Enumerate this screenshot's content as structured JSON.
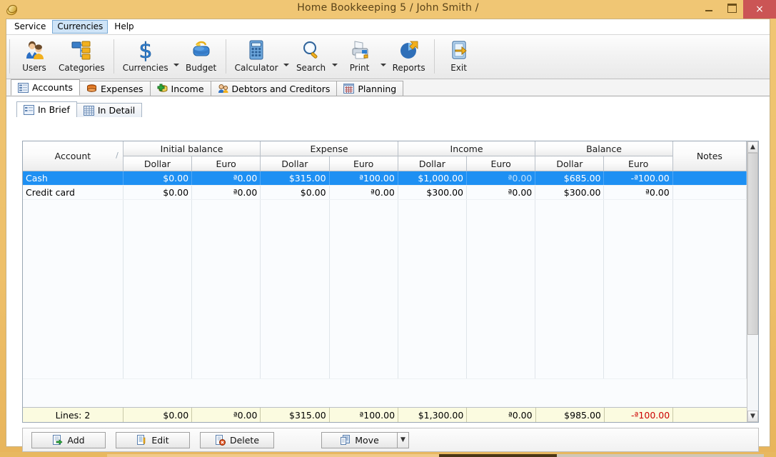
{
  "window": {
    "title": "Home Bookkeeping 5  / John Smith /",
    "icon": "coins-icon",
    "minimize": "minimize-button",
    "maximize": "maximize-button",
    "close": "×",
    "accent": "#e8b860",
    "titlebar_color": "#f0c674",
    "close_color": "#cb5555"
  },
  "menubar": {
    "items": [
      {
        "label": "Service",
        "active": false
      },
      {
        "label": "Currencies",
        "active": true
      },
      {
        "label": "Help",
        "active": false
      }
    ]
  },
  "toolbar": {
    "groups": [
      {
        "items": [
          {
            "label": "Users",
            "icon": "users-icon",
            "dropdown": false
          },
          {
            "label": "Categories",
            "icon": "categories-icon",
            "dropdown": false
          }
        ]
      },
      {
        "items": [
          {
            "label": "Currencies",
            "icon": "dollar-sign-icon",
            "dropdown": true
          },
          {
            "label": "Budget",
            "icon": "purse-icon",
            "dropdown": false
          }
        ]
      },
      {
        "items": [
          {
            "label": "Calculator",
            "icon": "calculator-icon",
            "dropdown": true
          },
          {
            "label": "Search",
            "icon": "magnifier-icon",
            "dropdown": true
          },
          {
            "label": "Print",
            "icon": "printer-icon",
            "dropdown": true
          },
          {
            "label": "Reports",
            "icon": "pie-chart-icon",
            "dropdown": false
          }
        ]
      },
      {
        "items": [
          {
            "label": "Exit",
            "icon": "exit-door-icon",
            "dropdown": false
          }
        ]
      }
    ]
  },
  "main_tabs": [
    {
      "label": "Accounts",
      "icon": "accounts-icon",
      "selected": true
    },
    {
      "label": "Expenses",
      "icon": "expenses-icon",
      "selected": false
    },
    {
      "label": "Income",
      "icon": "income-icon",
      "selected": false
    },
    {
      "label": "Debtors and Creditors",
      "icon": "debtors-icon",
      "selected": false
    },
    {
      "label": "Planning",
      "icon": "planning-icon",
      "selected": false
    }
  ],
  "sub_tabs": [
    {
      "label": "In Brief",
      "icon": "brief-list-icon",
      "selected": true
    },
    {
      "label": "In Detail",
      "icon": "detail-table-icon",
      "selected": false
    }
  ],
  "grid": {
    "group_headers": [
      {
        "label": "Account",
        "span": 1,
        "sort": "/"
      },
      {
        "label": "Initial balance",
        "span": 2
      },
      {
        "label": "Expense",
        "span": 2
      },
      {
        "label": "Income",
        "span": 2
      },
      {
        "label": "Balance",
        "span": 2
      },
      {
        "label": "Notes",
        "span": 1
      }
    ],
    "sub_headers": [
      "Dollar",
      "Euro",
      "Dollar",
      "Euro",
      "Dollar",
      "Euro",
      "Dollar",
      "Euro"
    ],
    "rows": [
      {
        "selected": true,
        "account": "Cash",
        "initial_dollar": "$0.00",
        "initial_euro": "ª0.00",
        "expense_dollar": "$315.00",
        "expense_euro": "ª100.00",
        "income_dollar": "$1,000.00",
        "income_euro": "ª0.00",
        "balance_dollar": "$685.00",
        "balance_euro": "-ª100.00",
        "notes": "",
        "dim": {
          "initial_dollar": false,
          "initial_euro": false,
          "expense_dollar": false,
          "expense_euro": false,
          "income_dollar": false,
          "income_euro": true,
          "balance_dollar": false,
          "balance_euro": false
        }
      },
      {
        "selected": false,
        "account": "Credit card",
        "initial_dollar": "$0.00",
        "initial_euro": "ª0.00",
        "expense_dollar": "$0.00",
        "expense_euro": "ª0.00",
        "income_dollar": "$300.00",
        "income_euro": "ª0.00",
        "balance_dollar": "$300.00",
        "balance_euro": "ª0.00",
        "notes": "",
        "dim": {
          "initial_dollar": true,
          "initial_euro": true,
          "expense_dollar": true,
          "expense_euro": true,
          "income_dollar": false,
          "income_euro": true,
          "balance_dollar": false,
          "balance_euro": false
        }
      }
    ],
    "footer": {
      "lines_label": "Lines: 2",
      "initial_dollar": "$0.00",
      "initial_euro": "ª0.00",
      "expense_dollar": "$315.00",
      "expense_euro": "ª100.00",
      "income_dollar": "$1,300.00",
      "income_euro": "ª0.00",
      "balance_dollar": "$985.00",
      "balance_euro": "-ª100.00",
      "notes": "",
      "negative_color": "#cc0000"
    },
    "scrollbar": {
      "up": "▲",
      "down": "▼"
    }
  },
  "buttons": [
    {
      "label": "Add",
      "icon": "add-record-icon"
    },
    {
      "label": "Edit",
      "icon": "edit-record-icon"
    },
    {
      "label": "Delete",
      "icon": "delete-record-icon"
    },
    {
      "label": "Move",
      "icon": "move-record-icon",
      "split": true,
      "arrow": "▼"
    }
  ]
}
